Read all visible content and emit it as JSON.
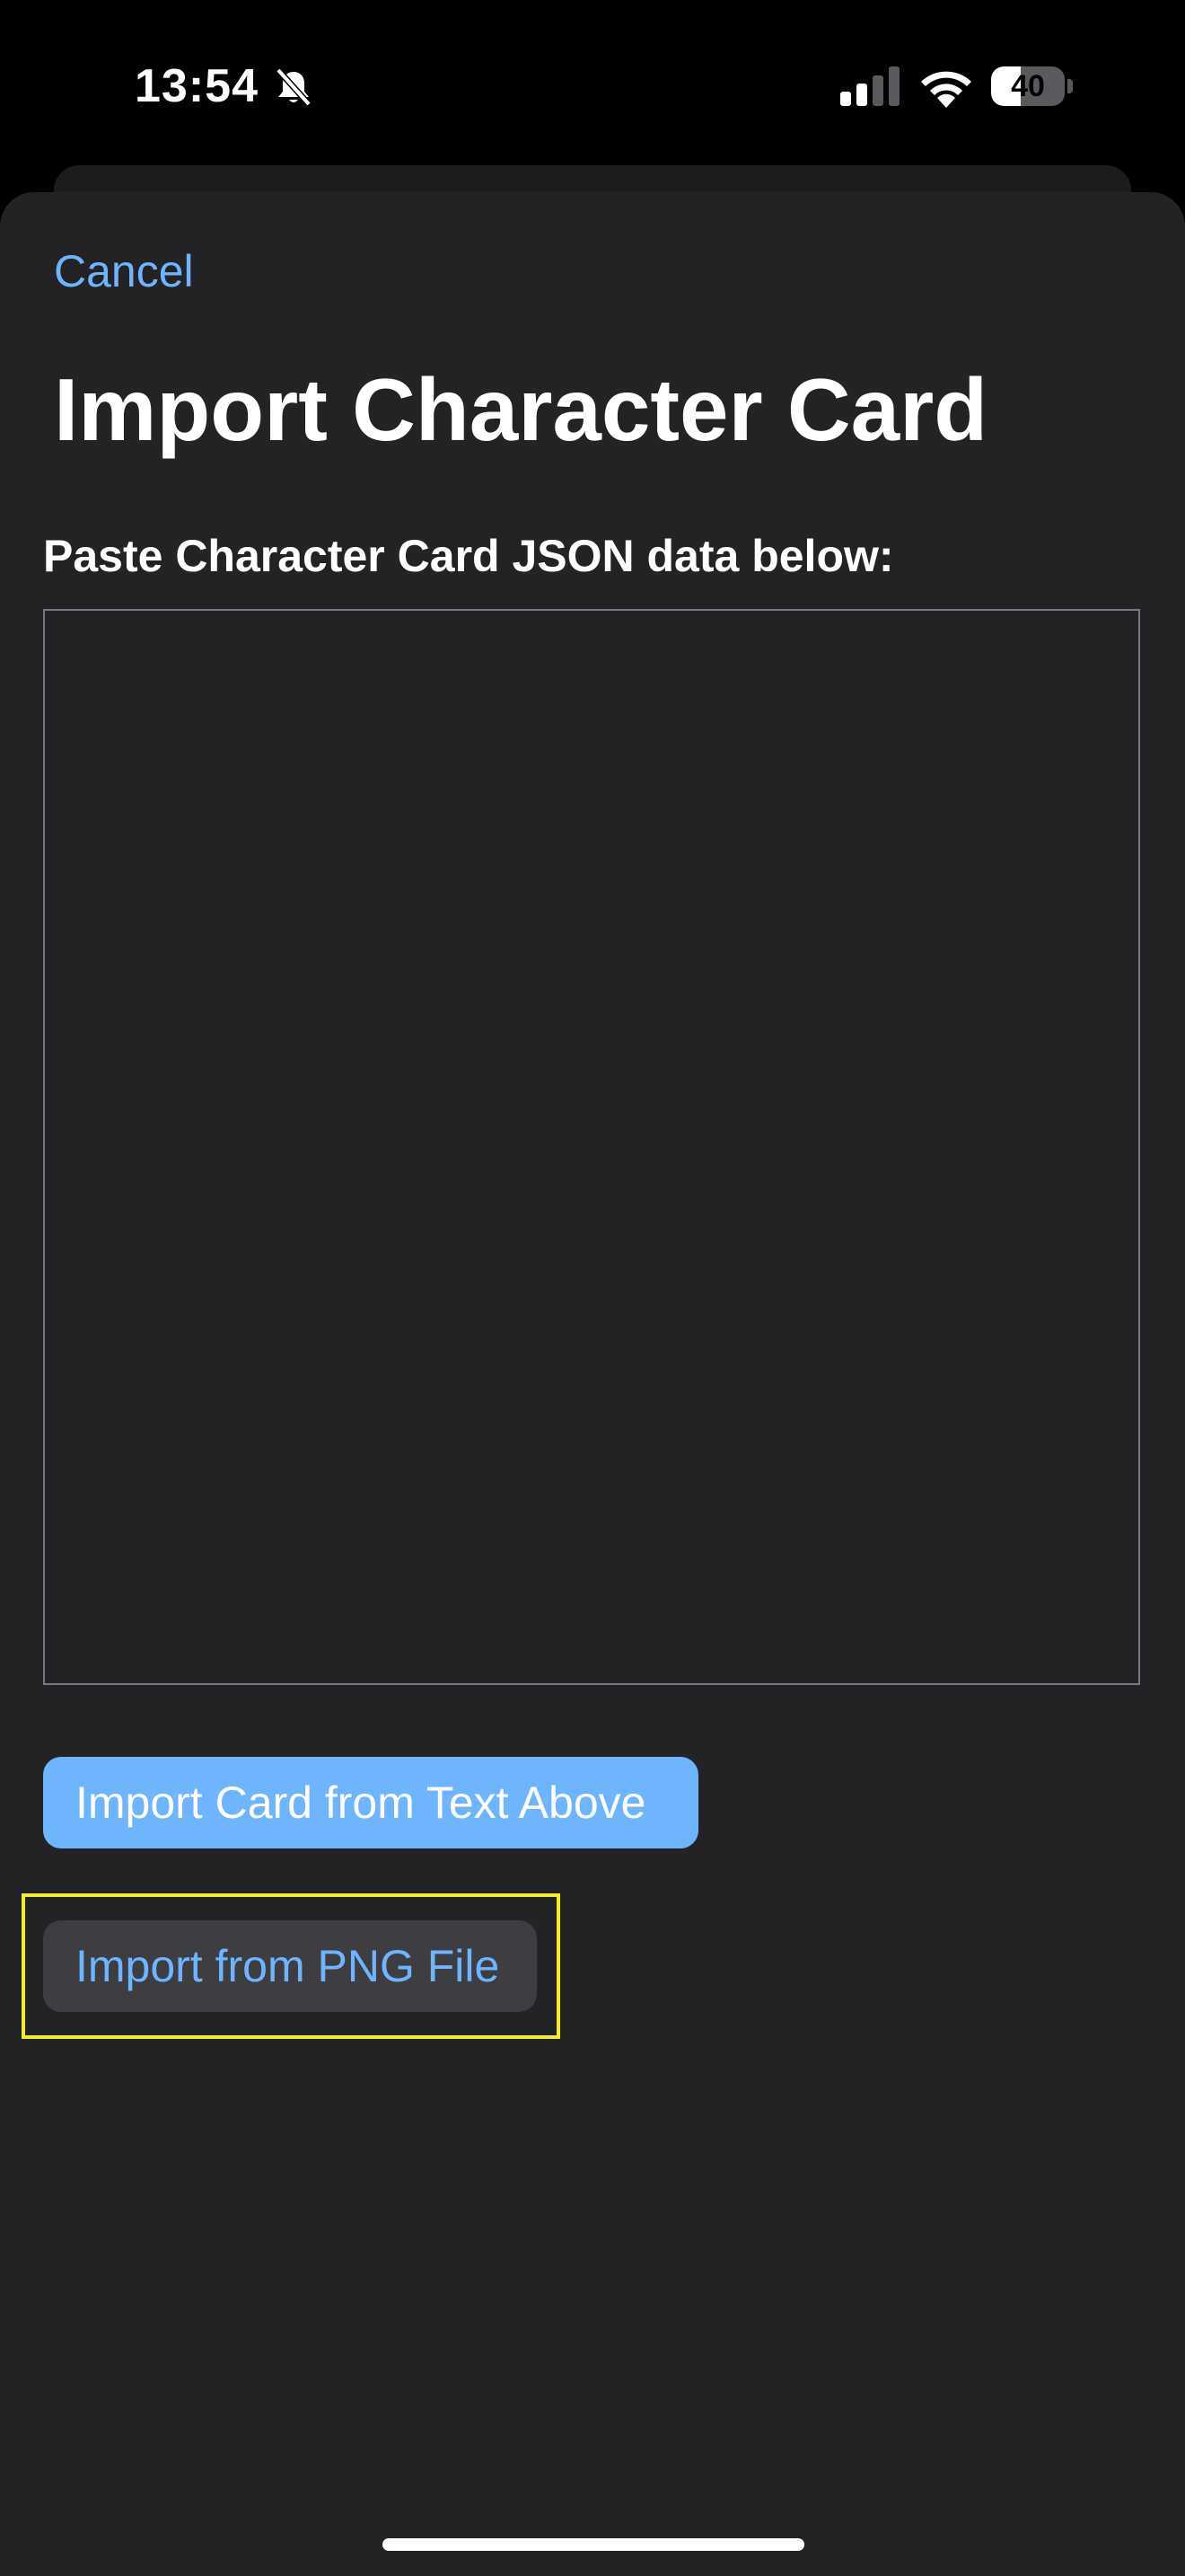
{
  "status_bar": {
    "time": "13:54",
    "battery_level": "40",
    "battery_fraction": 0.4,
    "icons": [
      "bell-slash-icon",
      "cellular-signal-icon",
      "wifi-icon",
      "battery-icon"
    ]
  },
  "sheet": {
    "cancel_label": "Cancel",
    "title": "Import Character Card",
    "instruction": "Paste Character Card JSON data below:",
    "json_input": {
      "value": "",
      "placeholder": ""
    },
    "import_text_button": "Import Card from Text Above",
    "import_png_button": "Import from PNG File"
  },
  "colors": {
    "accent": "#6eb4ff",
    "sheet_background": "#232325",
    "secondary_button": "#3e3e42",
    "highlight": "#f2ee2e"
  }
}
